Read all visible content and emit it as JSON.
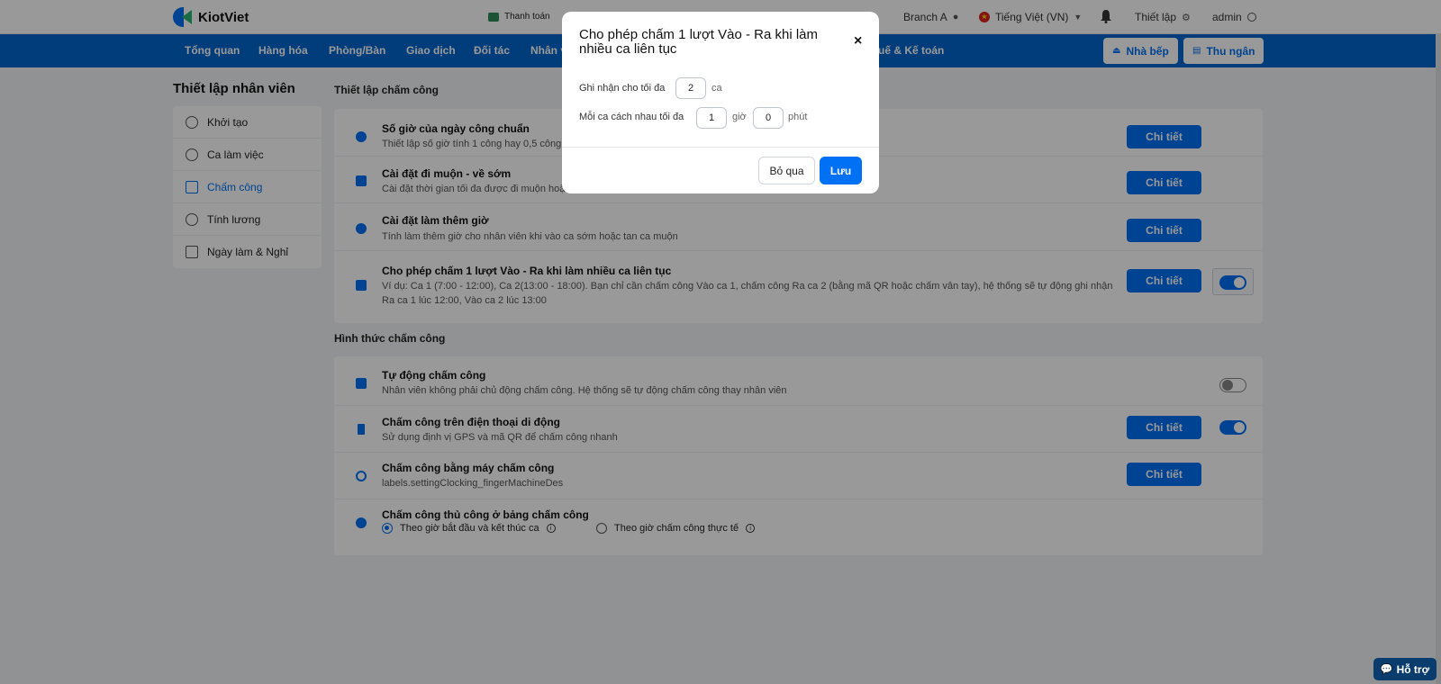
{
  "header": {
    "logo": "KiotViet",
    "payment": "Thanh toán",
    "branch": "Branch A",
    "language": "Tiếng Việt (VN)",
    "settings": "Thiết lập",
    "user": "admin"
  },
  "nav": {
    "items": [
      "Tổng quan",
      "Hàng hóa",
      "Phòng/Bàn",
      "Giao dịch",
      "Đối tác",
      "Nhân v",
      "uế & Kế toán"
    ],
    "kitchen": "Nhà bếp",
    "cashier": "Thu ngân"
  },
  "sidebar": {
    "title": "Thiết lập nhân viên",
    "items": [
      {
        "label": "Khởi tạo"
      },
      {
        "label": "Ca làm việc"
      },
      {
        "label": "Chấm công"
      },
      {
        "label": "Tính lương"
      },
      {
        "label": "Ngày làm & Nghỉ"
      }
    ]
  },
  "section1": {
    "title": "Thiết lập chấm công",
    "rows": [
      {
        "title": "Số giờ của ngày công chuẩn",
        "desc": "Thiết lập số giờ tính 1 công hay 0,5 công c",
        "button": "Chi tiết"
      },
      {
        "title": "Cài đặt đi muộn - về sớm",
        "desc": "Cài đặt thời gian tối đa được đi muộn hoặc về sớm",
        "button": "Chi tiết"
      },
      {
        "title": "Cài đặt làm thêm giờ",
        "desc": "Tính làm thêm giờ cho nhân viên khi vào ca sớm hoặc tan ca muộn",
        "button": "Chi tiết"
      },
      {
        "title": "Cho phép chấm 1 lượt Vào - Ra khi làm nhiều ca liên tục",
        "desc": "Ví dụ: Ca 1 (7:00 - 12:00), Ca 2(13:00 - 18:00). Bạn chỉ cần chấm công Vào ca 1, chấm công Ra ca 2 (bằng mã QR hoặc chấm vân tay), hệ thống sẽ tự động ghi nhận Ra ca 1 lúc 12:00, Vào ca 2 lúc 13:00",
        "button": "Chi tiết"
      }
    ]
  },
  "section2": {
    "title": "Hình thức chấm công",
    "rows": [
      {
        "title": "Tự động chấm công",
        "desc": "Nhân viên không phải chủ động chấm công. Hệ thống sẽ tự động chấm công thay nhân viên"
      },
      {
        "title": "Chấm công trên điện thoại di động",
        "desc": "Sử dụng định vị GPS và mã QR để chấm công nhanh",
        "button": "Chi tiết"
      },
      {
        "title": "Chấm công bằng máy chấm công",
        "desc": "labels.settingClocking_fingerMachineDes",
        "button": "Chi tiết"
      },
      {
        "title": "Chấm công thủ công ở bảng chấm công",
        "option1": "Theo giờ bắt đầu và kết thúc ca",
        "option2": "Theo giờ chấm công thực tế"
      }
    ]
  },
  "modal": {
    "title": "Cho phép chấm 1 lượt Vào - Ra khi làm nhiều ca liên tục",
    "close": "×",
    "max_label": "Ghi nhận cho tối đa",
    "max_value": "2",
    "max_unit": "ca",
    "gap_label": "Mỗi ca cách nhau tối đa",
    "gap_hours": "1",
    "hours_unit": "giờ",
    "gap_minutes": "0",
    "minutes_unit": "phút",
    "cancel": "Bỏ qua",
    "save": "Lưu"
  },
  "help": "Hỗ trợ"
}
